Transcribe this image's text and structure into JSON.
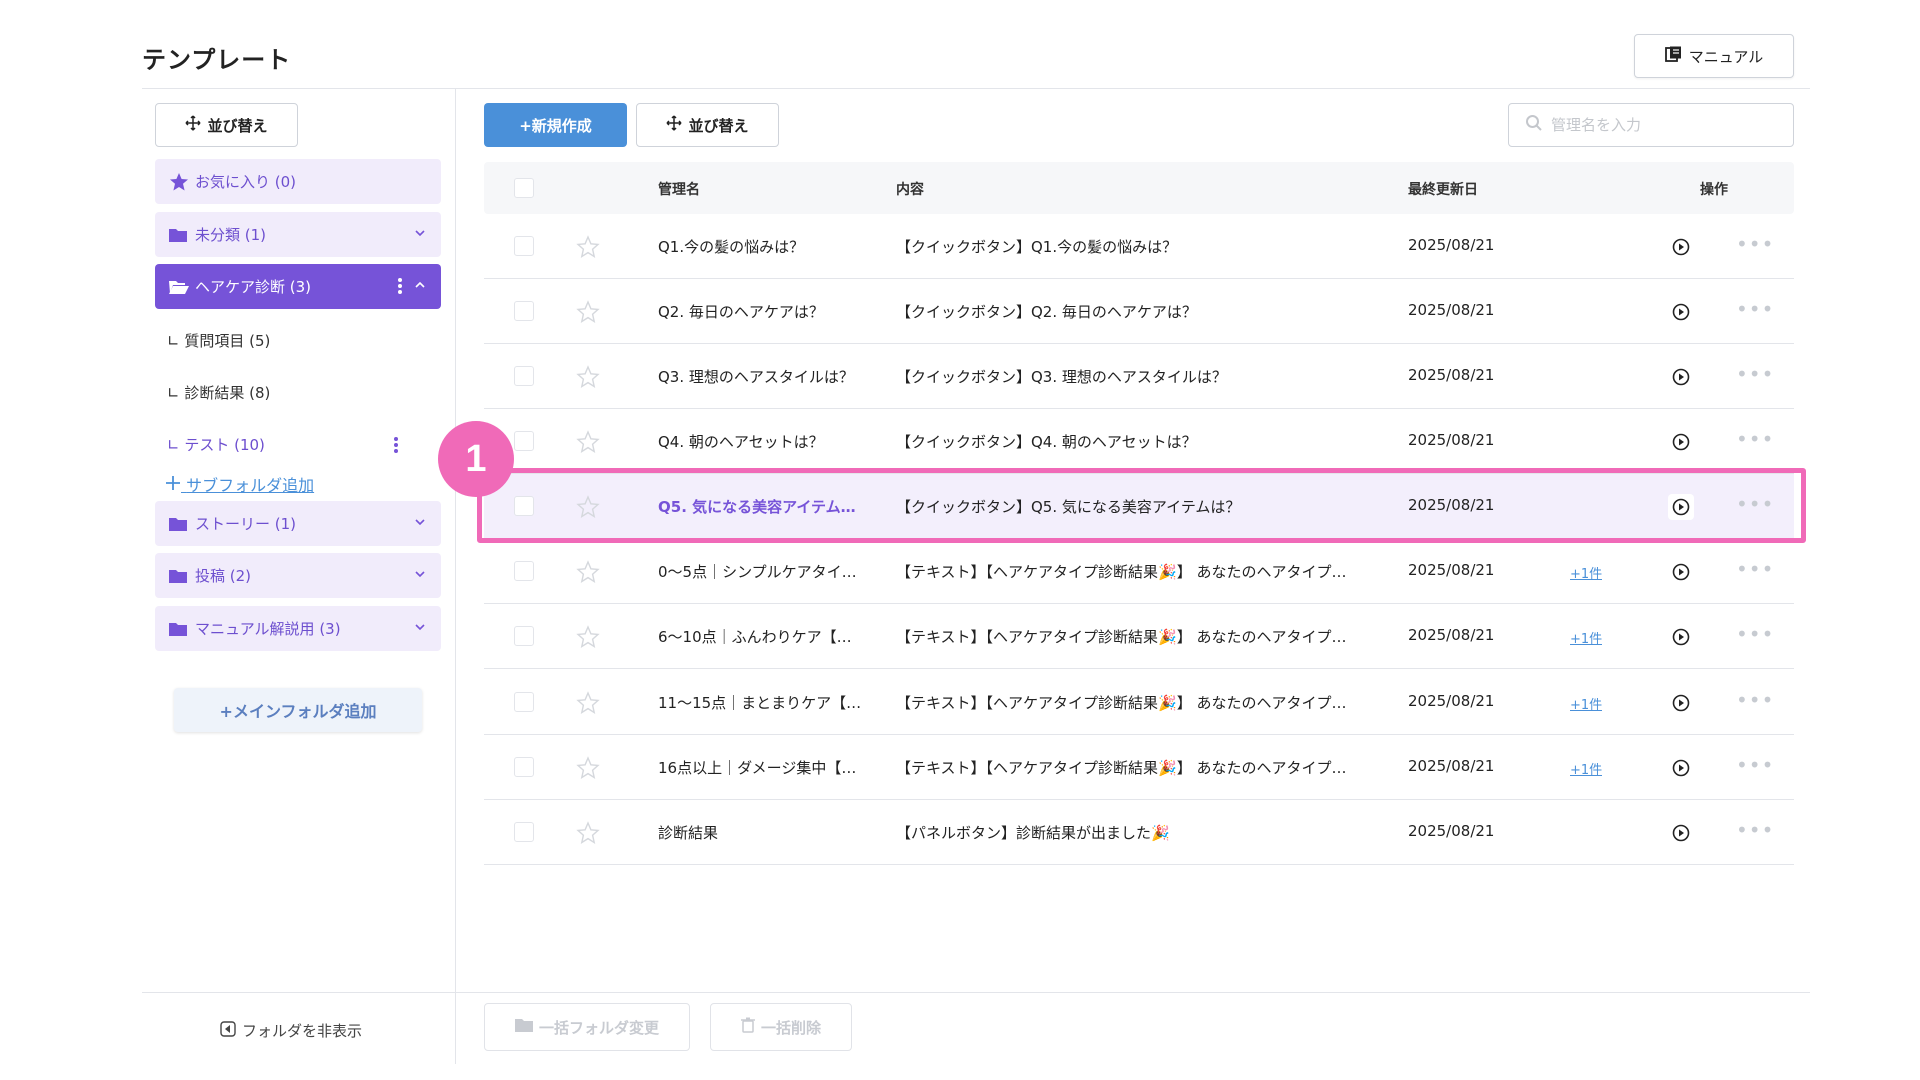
{
  "header": {
    "title": "テンプレート",
    "manual_label": "マニュアル"
  },
  "sidebar": {
    "sort_label": "並び替え",
    "favorites": "お気に入り (0)",
    "folders": [
      {
        "label": "未分類 (1)"
      },
      {
        "label": "ヘアケア診断 (3)"
      },
      {
        "label": "ストーリー (1)"
      },
      {
        "label": "投稿 (2)"
      },
      {
        "label": "マニュアル解説用 (3)"
      }
    ],
    "subfolders": [
      {
        "label": "∟ 質問項目 (5)"
      },
      {
        "label": "∟ 診断結果 (8)"
      },
      {
        "label": "∟ テスト (10)"
      }
    ],
    "add_subfolder": "サブフォルダ追加",
    "add_main_folder": "+メインフォルダ追加",
    "hide_folder": "フォルダを非表示"
  },
  "toolbar": {
    "new_label": "+新規作成",
    "sort_label": "並び替え",
    "search_placeholder": "管理名を入力"
  },
  "table": {
    "headers": {
      "name": "管理名",
      "content": "内容",
      "updated": "最終更新日",
      "action": "操作"
    },
    "rows": [
      {
        "name": "Q1.今の髪の悩みは？",
        "content": "【クイックボタン】Q1.今の髪の悩みは？",
        "date": "2025/08/21",
        "extra": ""
      },
      {
        "name": "Q2. 毎日のヘアケアは？",
        "content": "【クイックボタン】Q2. 毎日のヘアケアは？",
        "date": "2025/08/21",
        "extra": ""
      },
      {
        "name": "Q3. 理想のヘアスタイルは？",
        "content": "【クイックボタン】Q3. 理想のヘアスタイルは？",
        "date": "2025/08/21",
        "extra": ""
      },
      {
        "name": "Q4. 朝のヘアセットは？",
        "content": "【クイックボタン】Q4. 朝のヘアセットは？",
        "date": "2025/08/21",
        "extra": ""
      },
      {
        "name": "Q5. 気になる美容アイテム…",
        "content": "【クイックボタン】Q5. 気になる美容アイテムは？",
        "date": "2025/08/21",
        "extra": ""
      },
      {
        "name": "0〜5点｜シンプルケアタイ…",
        "content": "【テキスト】【ヘアケアタイプ診断結果🎉】 あなたのヘアタイプ…",
        "date": "2025/08/21",
        "extra": "+1件"
      },
      {
        "name": "6〜10点｜ふんわりケア【…",
        "content": "【テキスト】【ヘアケアタイプ診断結果🎉】 あなたのヘアタイプ…",
        "date": "2025/08/21",
        "extra": "+1件"
      },
      {
        "name": "11〜15点｜まとまりケア【…",
        "content": "【テキスト】【ヘアケアタイプ診断結果🎉】 あなたのヘアタイプ…",
        "date": "2025/08/21",
        "extra": "+1件"
      },
      {
        "name": "16点以上｜ダメージ集中【…",
        "content": "【テキスト】【ヘアケアタイプ診断結果🎉】 あなたのヘアタイプ…",
        "date": "2025/08/21",
        "extra": "+1件"
      },
      {
        "name": "診断結果",
        "content": "【パネルボタン】診断結果が出ました🎉",
        "date": "2025/08/21",
        "extra": ""
      }
    ]
  },
  "bulk_actions": {
    "change_folder": "一括フォルダ変更",
    "delete": "一括削除"
  },
  "annotation": {
    "step": "1"
  },
  "colors": {
    "accent": "#7653d8",
    "primary_blue": "#4a90d9",
    "highlight_pink": "#f06ab8"
  }
}
